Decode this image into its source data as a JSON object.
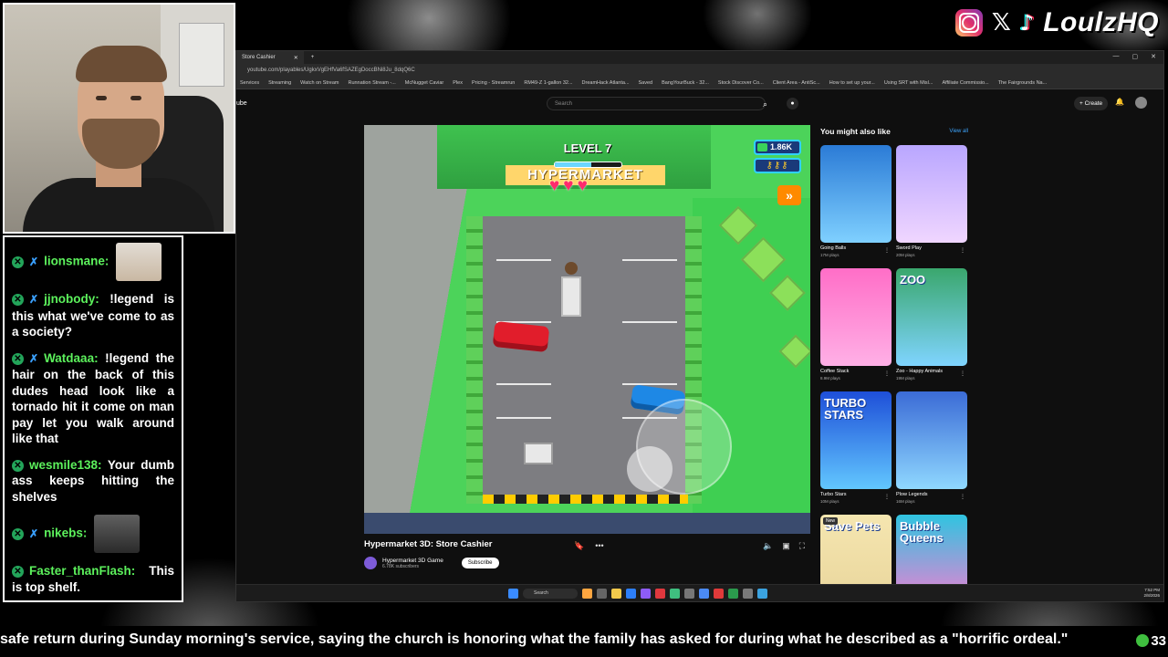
{
  "stream": {
    "handle": "LoulzHQ",
    "socials": [
      "instagram-icon",
      "x-icon",
      "tiktok-icon"
    ]
  },
  "chat": {
    "messages": [
      {
        "user": "lionsmane:",
        "text": "",
        "has_avatar": true
      },
      {
        "user": "jjnobody:",
        "text": "!legend is this what we've come to as a society?"
      },
      {
        "user": "Watdaaa:",
        "text": "!legend the hair on the back of this dudes head look like a tornado hit it come on man pay let you walk around like that"
      },
      {
        "user": "wesmile138:",
        "text": "Your dumb ass keeps hitting the shelves"
      },
      {
        "user": "nikebs:",
        "text": "",
        "has_avatar": true
      },
      {
        "user": "Faster_thanFlash:",
        "text": "This is top shelf."
      }
    ]
  },
  "browser": {
    "tab_title": "Store Cashier",
    "url": "youtube.com/playables/UgkxVgEHfVa6fSAZEgDoccBNi8Ju_8dqQ6C",
    "bookmarks": [
      "Services",
      "Streaming",
      "Watch on Stream",
      "Runnation Stream -...",
      "McNugget Caviar",
      "Plex",
      "Pricing - Streamrun",
      "RM49-Z 1-gallon 32...",
      "DreamHack Atlanta...",
      "Saved",
      "BangYourBuck - 32...",
      "Stock Discover Co...",
      "Client Area - AntiSc...",
      "How to set up your...",
      "Using SRT with Misl...",
      "Affiliate Commissio...",
      "The Fairgrounds Na..."
    ]
  },
  "youtube": {
    "logo_text": "ube",
    "search_placeholder": "Search",
    "create_label": "Create"
  },
  "game": {
    "level_label": "LEVEL 7",
    "level_progress": 0.55,
    "store_sign": "HYPERMARKET",
    "cash": "1.86K",
    "hearts": 3,
    "keys": "⚷⚷⚷",
    "fast_forward": "»"
  },
  "video": {
    "title": "Hypermarket 3D: Store Cashier",
    "channel": "Hypermarket 3D Game",
    "subscribers": "6.78K subscribers",
    "subscribe_label": "Subscribe"
  },
  "sidebar": {
    "heading": "You might also like",
    "view_all": "View all",
    "games": [
      {
        "title": "Going Balls",
        "plays": "17M plays",
        "colors": [
          "#2b7bd6",
          "#7fd0ff"
        ],
        "label": ""
      },
      {
        "title": "Sword Play",
        "plays": "20M plays",
        "colors": [
          "#b9a6ff",
          "#f0d6ff"
        ],
        "label": ""
      },
      {
        "title": "Coffee Stack",
        "plays": "8.9M plays",
        "colors": [
          "#ff6ec7",
          "#ffb0e6"
        ],
        "label": ""
      },
      {
        "title": "Zoo - Happy Animals",
        "plays": "19M plays",
        "colors": [
          "#3aa76d",
          "#7fd4ff"
        ],
        "label": "ZOO"
      },
      {
        "title": "Turbo Stars",
        "plays": "10M plays",
        "colors": [
          "#1e4fd8",
          "#62c7ff"
        ],
        "label": "TURBO STARS"
      },
      {
        "title": "Plow Legends",
        "plays": "16M plays",
        "colors": [
          "#3b6bd6",
          "#8fd8ff"
        ],
        "label": ""
      },
      {
        "title": "",
        "plays": "",
        "colors": [
          "#f5e6b0",
          "#e8d49a"
        ],
        "label": "Save Pets",
        "badge": "New"
      },
      {
        "title": "",
        "plays": "",
        "colors": [
          "#2fc4e0",
          "#ff7ad1"
        ],
        "label": "Bubble Queens"
      }
    ]
  },
  "taskbar": {
    "search_label": "Search",
    "time": "7:52 PM",
    "date": "2/8/2026"
  },
  "ticker": {
    "text": "safe return during Sunday morning's service, saying the church is honoring what the family has asked for during what he described as a \"horrific ordeal.\"",
    "counter": "33"
  }
}
